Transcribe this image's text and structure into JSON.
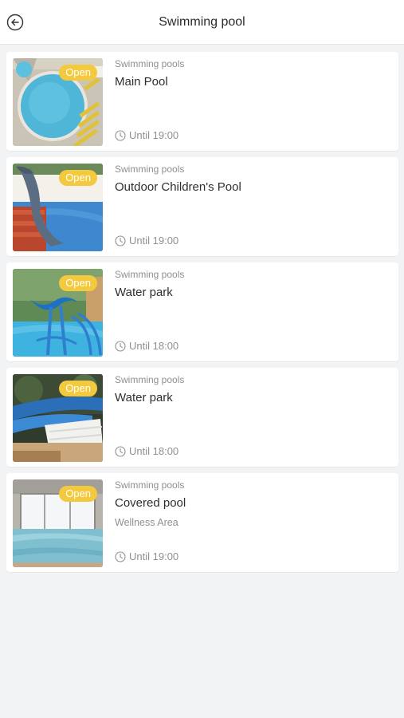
{
  "header": {
    "title": "Swimming pool",
    "back_icon": "arrow-left-circle-icon"
  },
  "pools": [
    {
      "category": "Swimming pools",
      "name": "Main Pool",
      "subtitle": "",
      "status": "Open",
      "hours": "Until 19:00"
    },
    {
      "category": "Swimming pools",
      "name": "Outdoor Children's Pool",
      "subtitle": "",
      "status": "Open",
      "hours": "Until 19:00"
    },
    {
      "category": "Swimming pools",
      "name": "Water park",
      "subtitle": "",
      "status": "Open",
      "hours": "Until 18:00"
    },
    {
      "category": "Swimming pools",
      "name": "Water park",
      "subtitle": "",
      "status": "Open",
      "hours": "Until 18:00"
    },
    {
      "category": "Swimming pools",
      "name": "Covered pool",
      "subtitle": "Wellness Area",
      "status": "Open",
      "hours": "Until 19:00"
    }
  ],
  "colors": {
    "badge": "#f3c93e",
    "background": "#f2f3f5",
    "muted_text": "#8f8f94"
  }
}
